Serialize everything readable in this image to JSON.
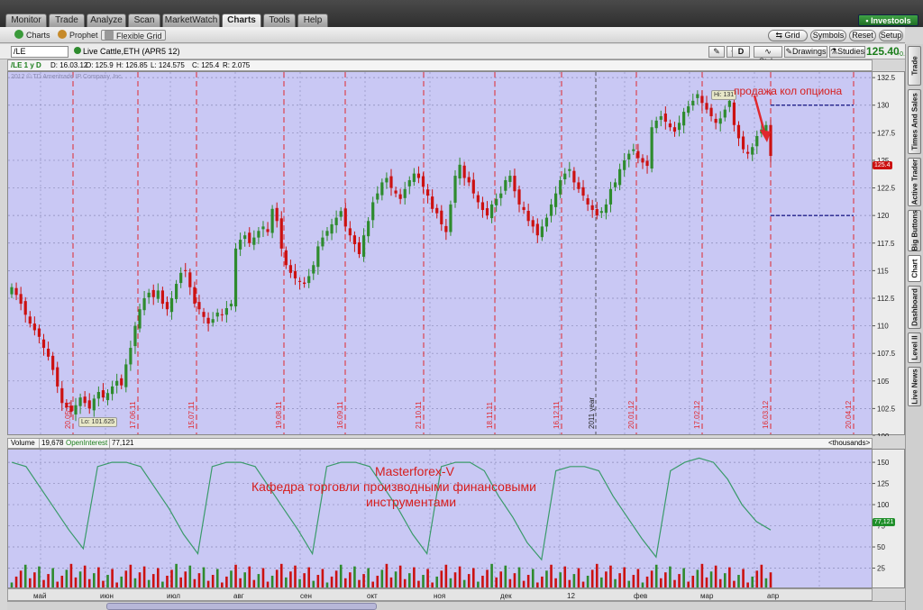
{
  "main_tabs": [
    {
      "label": "Monitor",
      "active": false
    },
    {
      "label": "Trade",
      "active": false
    },
    {
      "label": "Analyze",
      "active": false
    },
    {
      "label": "Scan",
      "active": false
    },
    {
      "label": "MarketWatch",
      "active": false
    },
    {
      "label": "Charts",
      "active": true
    },
    {
      "label": "Tools",
      "active": false
    },
    {
      "label": "Help",
      "active": false
    }
  ],
  "brand": {
    "label": "Investools",
    "color": "#2e8b35"
  },
  "sub_toolbar": {
    "charts": "Charts",
    "prophet": "Prophet",
    "flexible_grid": "Flexible Grid",
    "grid": "Grid",
    "symbols": "Symbols",
    "reset": "Reset",
    "setup": "Setup"
  },
  "chart_toolbar": {
    "symbol": "/LE",
    "description": "Live Cattle,ETH (APR5 12)",
    "period_button": "D",
    "style": "Style",
    "drawings": "Drawings",
    "studies": "Studies",
    "last_price": "125.40",
    "change": "+.10",
    "change_pct": "+0.08%"
  },
  "ohlc_header": {
    "aggregation": "/LE 1 y D",
    "date": "D: 16.03.12",
    "open": "O: 125.9",
    "high": "H: 126.85",
    "low": "L: 124.575",
    "close": "C: 125.4",
    "range": "R: 2.075"
  },
  "copyright": "2012 © TD Ameritrade IP Company, Inc.",
  "right_tabs": [
    "Trade",
    "Times And Sales",
    "Active Trader",
    "Big Buttons",
    "Chart",
    "Dashboard",
    "Level II",
    "Live News"
  ],
  "volume_header": {
    "volume_label": "Volume",
    "volume_value": "19,678",
    "oi_label": "OpenInterest",
    "oi_value": "77,121",
    "units": "<thousands>"
  },
  "month_labels": [
    "май",
    "июн",
    "июл",
    "авг",
    "сен",
    "окт",
    "ноя",
    "дек",
    "12",
    "фев",
    "мар",
    "апр"
  ],
  "annotations": {
    "hi_label": "Hi: 131",
    "lo_label": "Lo: 101.625",
    "price_tag": "125.4",
    "oi_tag": "77,121",
    "option_note": "продажа кол опциона",
    "year_marker": "2011 year",
    "promo_line1": "Masterforex-V",
    "promo_line2": "Кафедра торговли производными финансовыми",
    "promo_line3": "инструментами"
  },
  "colors": {
    "up": "#2e8b2e",
    "down": "#cc1111",
    "panel_bg": "#c9c8f4",
    "marker": "#e0282e",
    "level_line": "#22228a",
    "oi_line": "#3a9a6a"
  },
  "chart_data": [
    {
      "type": "candlestick",
      "x_labels": [
        "20.05.11",
        "17.06.11",
        "15.07.11",
        "19.08.11",
        "16.09.11",
        "21.10.11",
        "18.11.11",
        "16.12.11",
        "20.01.12",
        "17.02.12",
        "16.03.12",
        "20.04.12"
      ],
      "ylim": [
        100,
        133
      ],
      "y_ticks": [
        "132.5",
        "130",
        "127.5",
        "125",
        "122.5",
        "120",
        "117.5",
        "115",
        "112.5",
        "110",
        "107.5",
        "105",
        "102.5",
        "100"
      ],
      "levels": [
        130,
        120
      ],
      "high": 131,
      "low": 101.625,
      "last": 125.4,
      "closes": [
        113.5,
        112.8,
        112.0,
        111.0,
        110.2,
        109.6,
        109.0,
        108.0,
        107.2,
        106.0,
        104.5,
        103.0,
        102.6,
        102.2,
        102.8,
        103.5,
        103.0,
        102.5,
        103.4,
        104.0,
        103.5,
        103.9,
        104.5,
        105.0,
        104.6,
        106.5,
        108.0,
        110.0,
        111.5,
        112.5,
        113.0,
        112.6,
        113.2,
        112.0,
        111.5,
        112.5,
        113.8,
        114.8,
        115.0,
        113.5,
        112.0,
        111.5,
        110.8,
        110.2,
        110.6,
        111.2,
        111.0,
        111.6,
        112.0,
        117.0,
        117.8,
        118.2,
        117.5,
        118.0,
        118.6,
        119.0,
        118.5,
        120.6,
        119.5,
        117.0,
        115.5,
        114.8,
        114.3,
        114.0,
        113.8,
        114.5,
        115.5,
        117.2,
        118.0,
        118.6,
        119.2,
        119.8,
        120.4,
        119.0,
        118.2,
        117.4,
        116.5,
        118.2,
        119.5,
        121.2,
        122.0,
        123.0,
        123.4,
        122.5,
        122.0,
        121.5,
        122.4,
        123.2,
        123.8,
        123.4,
        122.6,
        121.8,
        120.6,
        120.2,
        119.2,
        118.5,
        121.0,
        123.6,
        124.6,
        123.4,
        123.0,
        122.0,
        121.2,
        120.5,
        120.0,
        121.0,
        121.5,
        122.0,
        123.2,
        123.6,
        122.2,
        121.0,
        120.5,
        119.5,
        119.0,
        118.2,
        119.0,
        119.8,
        121.0,
        122.0,
        123.2,
        123.8,
        124.2,
        123.0,
        122.4,
        121.8,
        121.0,
        120.5,
        120.0,
        120.4,
        121.0,
        122.4,
        123.0,
        124.2,
        125.0,
        125.6,
        126.0,
        125.2,
        124.8,
        124.5,
        128.0,
        128.6,
        129.0,
        128.5,
        128.0,
        127.6,
        128.4,
        129.4,
        129.9,
        130.4,
        131.0,
        130.2,
        129.6,
        129.0,
        128.4,
        128.8,
        129.6,
        130.4,
        128.2,
        127.0,
        126.0,
        125.6,
        126.2,
        127.2,
        127.8,
        128.2,
        125.4
      ]
    },
    {
      "type": "bar",
      "series": [
        {
          "name": "Volume"
        },
        {
          "name": "OpenInterest",
          "values": [
            150,
            145,
            120,
            95,
            70,
            48,
            145,
            150,
            150,
            145,
            120,
            95,
            65,
            42,
            145,
            150,
            150,
            145,
            120,
            95,
            70,
            42,
            145,
            150,
            150,
            145,
            120,
            95,
            65,
            42,
            145,
            150,
            150,
            140,
            110,
            85,
            55,
            35,
            140,
            145,
            145,
            140,
            110,
            85,
            60,
            38,
            140,
            150,
            155,
            150,
            130,
            100,
            80,
            70
          ],
          "last": "77,121"
        }
      ],
      "ylim": [
        0,
        165
      ],
      "y_ticks": [
        "150",
        "125",
        "100",
        "75",
        "50",
        "25"
      ],
      "x_labels": [
        "май",
        "июн",
        "июл",
        "авг",
        "сен",
        "окт",
        "ноя",
        "дек",
        "12",
        "фев",
        "мар",
        "апр"
      ],
      "y_units": "<thousands>"
    }
  ]
}
